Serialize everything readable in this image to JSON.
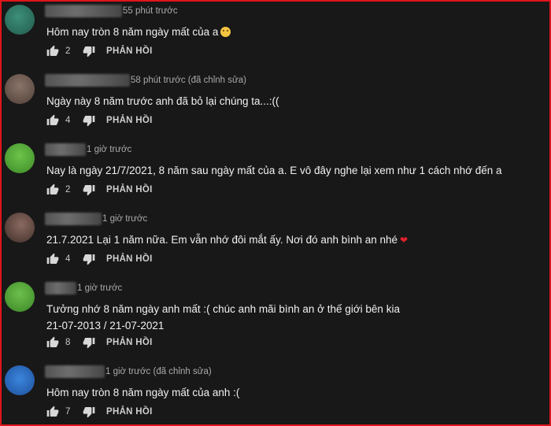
{
  "reply_label": "PHẢN HỒI",
  "comments": [
    {
      "time": "55 phút trước",
      "lines": [
        "Hôm nay tròn 8 năm ngày mất của a"
      ],
      "likes": "2",
      "emoji": "sad-face"
    },
    {
      "time": "58 phút trước (đã chỉnh sửa)",
      "lines": [
        "Ngày này 8 năm trước anh đã bỏ lại chúng ta...:(("
      ],
      "likes": "4"
    },
    {
      "time": "1 giờ trước",
      "lines": [
        "Nay là ngày 21/7/2021, 8 năm sau ngày mất của a. E vô đây nghe lại xem như 1 cách nhớ đến a"
      ],
      "likes": "2"
    },
    {
      "time": "1 giờ trước",
      "lines": [
        "21.7.2021 Lại 1 năm nữa. Em vẫn nhớ đôi mắt ấy. Nơi đó anh bình an nhé"
      ],
      "likes": "4",
      "emoji": "red-heart"
    },
    {
      "time": "1 giờ trước",
      "lines": [
        "Tưởng nhớ 8 năm ngày anh mất :( chúc anh mãi bình an ở thế giới bên kia",
        "21-07-2013 / 21-07-2021"
      ],
      "likes": "8"
    },
    {
      "time": "1 giờ trước (đã chỉnh sửa)",
      "lines": [
        "Hôm nay tròn 8 năm ngày mất của anh :("
      ],
      "likes": "7"
    }
  ],
  "colors": {
    "background": "#181818",
    "border": "#e0141b",
    "avatars": [
      "#2f7a68",
      "#6e5a52",
      "#5cae3c",
      "#6a514a",
      "#5a9f3e",
      "#2e6fc2"
    ]
  }
}
